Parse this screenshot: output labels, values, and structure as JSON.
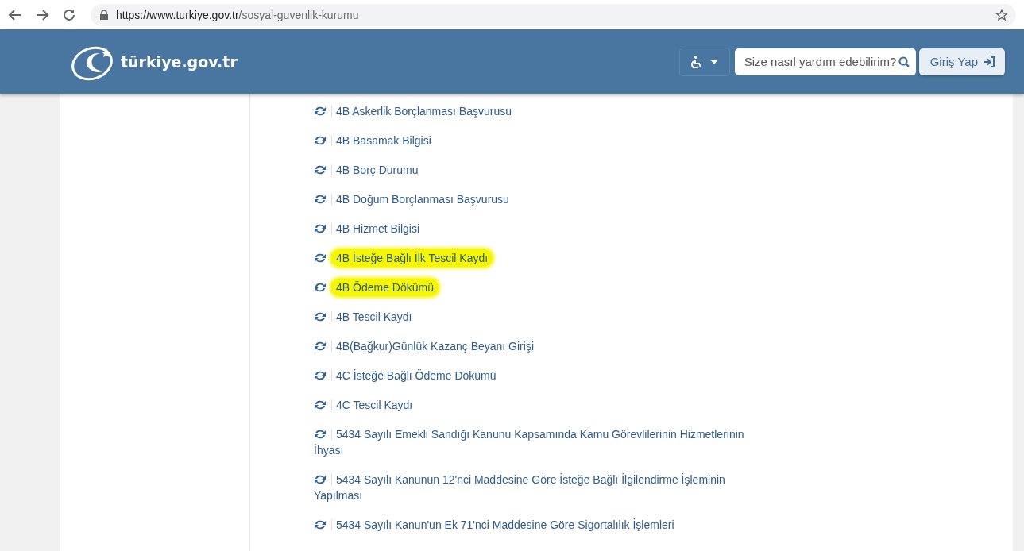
{
  "browser": {
    "url_host": "https://www.turkiye.gov.tr",
    "url_path": "/sosyal-guvenlik-kurumu"
  },
  "header": {
    "logo": "türkiye.gov.tr",
    "search": {
      "placeholder": "Size nasıl yardım edebilirim?"
    },
    "login_button": "Giriş Yap"
  },
  "services": [
    {
      "label": "4B Askerlik Borçlanması Başvurusu",
      "highlighted": false
    },
    {
      "label": "4B Basamak Bilgisi",
      "highlighted": false
    },
    {
      "label": "4B Borç Durumu",
      "highlighted": false
    },
    {
      "label": "4B Doğum Borçlanması Başvurusu",
      "highlighted": false
    },
    {
      "label": "4B Hizmet Bilgisi",
      "highlighted": false
    },
    {
      "label": "4B İsteğe Bağlı İlk Tescil Kaydı",
      "highlighted": true
    },
    {
      "label": "4B Ödeme Dökümü",
      "highlighted": true
    },
    {
      "label": "4B Tescil Kaydı",
      "highlighted": false
    },
    {
      "label": "4B(Bağkur)Günlük Kazanç Beyanı Girişi",
      "highlighted": false
    },
    {
      "label": "4C İsteğe Bağlı Ödeme Dökümü",
      "highlighted": false
    },
    {
      "label": "4C Tescil Kaydı",
      "highlighted": false
    },
    {
      "label": "5434 Sayılı Emekli Sandığı Kanunu Kapsamında Kamu Görevlilerinin Hizmetlerinin İhyası",
      "highlighted": false
    },
    {
      "label": "5434 Sayılı Kanunun 12'nci Maddesine Göre İsteğe Bağlı İlgilendirme İşleminin Yapılması",
      "highlighted": false
    },
    {
      "label": "5434 Sayılı Kanun'un Ek 71'nci Maddesine Göre Sigortalılık İşlemleri",
      "highlighted": false
    }
  ]
}
